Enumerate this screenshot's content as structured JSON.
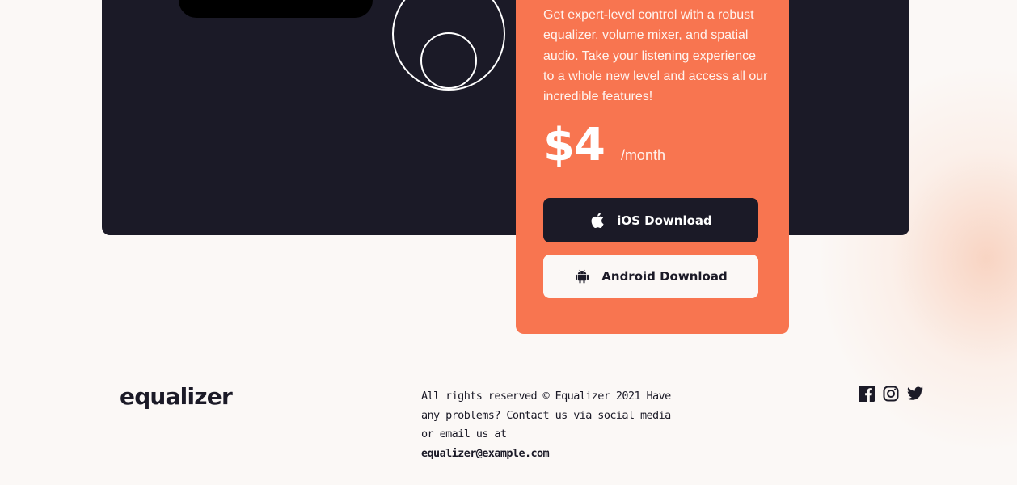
{
  "pricing": {
    "description": "Get expert-level control with a robust equalizer, volume mixer, and spatial audio. Take your listening experience to a whole new level and access all our incredible features!",
    "price": "$4",
    "period": "/month",
    "ios_button_label": "iOS Download",
    "android_button_label": "Android Download"
  },
  "footer": {
    "logo": "equalizer",
    "text": "All rights reserved © Equalizer 2021 Have any problems? Contact us via social media or email us at",
    "email": "equalizer@example.com",
    "social_icons": [
      "facebook-icon",
      "instagram-icon",
      "twitter-icon"
    ]
  },
  "colors": {
    "page_background": "#FBF8F6",
    "dark": "#1B1A27",
    "accent": "#F87550",
    "white": "#FFFFFF"
  }
}
